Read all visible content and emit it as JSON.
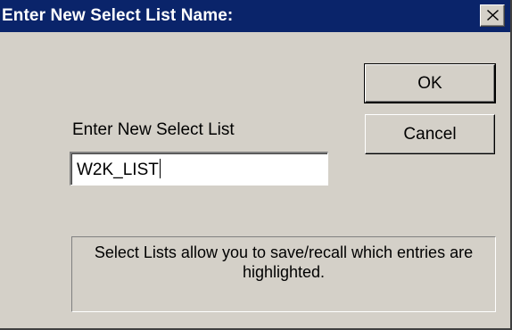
{
  "dialog": {
    "title": "Enter New Select List Name:",
    "close_icon": "close-x-icon",
    "ok_label": "OK",
    "cancel_label": "Cancel",
    "prompt_label": "Enter New Select List",
    "name_value": "W2K_LIST",
    "info_text": "Select Lists allow you to save/recall which entries are highlighted.",
    "colors": {
      "titlebar": "#0a246a",
      "face": "#d4d0c8",
      "title_text": "#ffffff"
    }
  }
}
